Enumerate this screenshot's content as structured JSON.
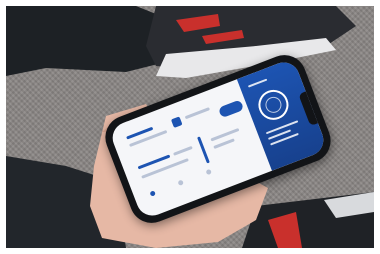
{
  "scene": {
    "colors": {
      "carpet": "#8b8785",
      "shoe_upper": "#2a2c31",
      "shoe_accent": "#c9302c",
      "shoe_sole": "#e8e8ea",
      "skin": "#e6b8a5",
      "sleeve": "#1d2125",
      "phone_frame": "#121417",
      "app_blue": "#1d54b2",
      "app_background": "#f5f6f9"
    },
    "icons": [
      "pills-icon",
      "gear-icon",
      "heart-icon"
    ]
  }
}
